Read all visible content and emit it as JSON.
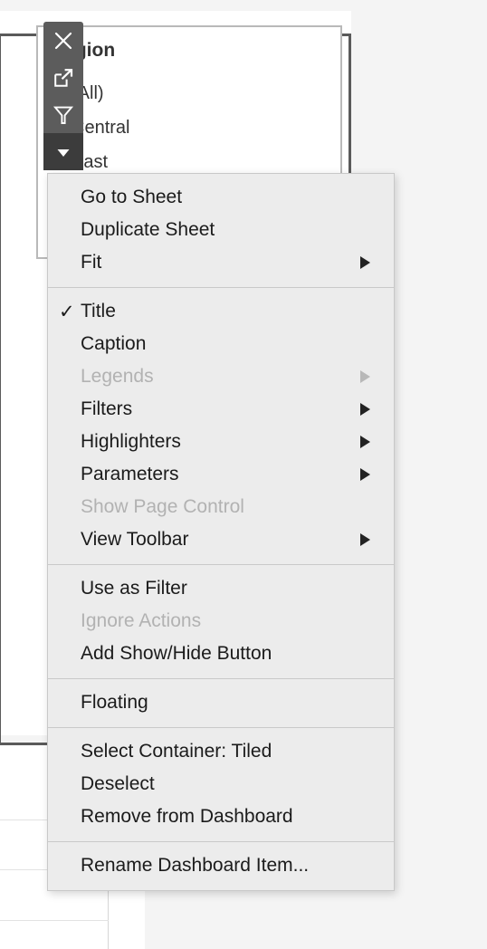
{
  "filter_card": {
    "title": "Region",
    "title_visible_fragment": "gion",
    "items": [
      {
        "label": "(All)",
        "checked": false
      },
      {
        "label": "Central",
        "checked": false
      },
      {
        "label": "East",
        "checked": false
      }
    ]
  },
  "sheet_toolbar": {
    "buttons": [
      {
        "icon": "close-icon",
        "name": "remove-from-dashboard-button",
        "active": false
      },
      {
        "icon": "external-link-icon",
        "name": "go-to-sheet-button",
        "active": false
      },
      {
        "icon": "filter-funnel-icon",
        "name": "use-as-filter-button",
        "active": false
      },
      {
        "icon": "caret-down-icon",
        "name": "more-options-button",
        "active": true
      }
    ]
  },
  "context_menu": {
    "sections": [
      {
        "items": [
          {
            "label": "Go to Sheet",
            "disabled": false,
            "checked": false,
            "submenu": false
          },
          {
            "label": "Duplicate Sheet",
            "disabled": false,
            "checked": false,
            "submenu": false
          },
          {
            "label": "Fit",
            "disabled": false,
            "checked": false,
            "submenu": true
          }
        ]
      },
      {
        "items": [
          {
            "label": "Title",
            "disabled": false,
            "checked": true,
            "submenu": false
          },
          {
            "label": "Caption",
            "disabled": false,
            "checked": false,
            "submenu": false
          },
          {
            "label": "Legends",
            "disabled": true,
            "checked": false,
            "submenu": true
          },
          {
            "label": "Filters",
            "disabled": false,
            "checked": false,
            "submenu": true
          },
          {
            "label": "Highlighters",
            "disabled": false,
            "checked": false,
            "submenu": true
          },
          {
            "label": "Parameters",
            "disabled": false,
            "checked": false,
            "submenu": true
          },
          {
            "label": "Show Page Control",
            "disabled": true,
            "checked": false,
            "submenu": false
          },
          {
            "label": "View Toolbar",
            "disabled": false,
            "checked": false,
            "submenu": true
          }
        ]
      },
      {
        "items": [
          {
            "label": "Use as Filter",
            "disabled": false,
            "checked": false,
            "submenu": false
          },
          {
            "label": "Ignore Actions",
            "disabled": true,
            "checked": false,
            "submenu": false
          },
          {
            "label": "Add Show/Hide Button",
            "disabled": false,
            "checked": false,
            "submenu": false
          }
        ]
      },
      {
        "items": [
          {
            "label": "Floating",
            "disabled": false,
            "checked": false,
            "submenu": false
          }
        ]
      },
      {
        "items": [
          {
            "label": "Select Container: Tiled",
            "disabled": false,
            "checked": false,
            "submenu": false
          },
          {
            "label": "Deselect",
            "disabled": false,
            "checked": false,
            "submenu": false
          },
          {
            "label": "Remove from Dashboard",
            "disabled": false,
            "checked": false,
            "submenu": false
          }
        ]
      },
      {
        "items": [
          {
            "label": "Rename Dashboard Item...",
            "disabled": false,
            "checked": false,
            "submenu": false
          }
        ]
      }
    ],
    "check_glyph": "✓"
  },
  "colors": {
    "page_background": "#f4f4f4",
    "menu_background": "#ececec",
    "menu_separator": "#c9c9c9",
    "toolbar_background": "#5c5c5c",
    "toolbar_active": "#3c3c3c",
    "text": "#1b1b1b",
    "text_disabled": "#b2b2b2",
    "panel_border": "#5a5a5a",
    "card_border": "#b9b9b9"
  }
}
